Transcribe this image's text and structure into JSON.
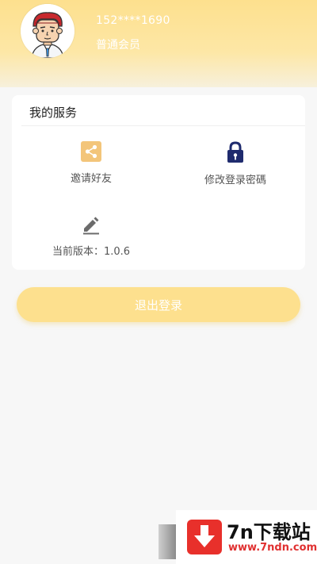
{
  "profile": {
    "phone": "152****1690",
    "member_level": "普通会员"
  },
  "services": {
    "title": "我的服务",
    "items": [
      {
        "label": "邀请好友",
        "icon": "share-icon"
      },
      {
        "label": "修改登录密碼",
        "icon": "lock-icon"
      },
      {
        "label": "当前版本：1.0.6",
        "icon": "edit-icon"
      }
    ]
  },
  "logout": {
    "label": "退出登录"
  },
  "watermark": {
    "title": "7n下载站",
    "url": "www.7ndn.com"
  },
  "colors": {
    "header_yellow": "#fde08e",
    "share_icon_bg": "#f3c57a",
    "lock_icon": "#1f2b6e",
    "button_yellow": "#fde08e"
  }
}
